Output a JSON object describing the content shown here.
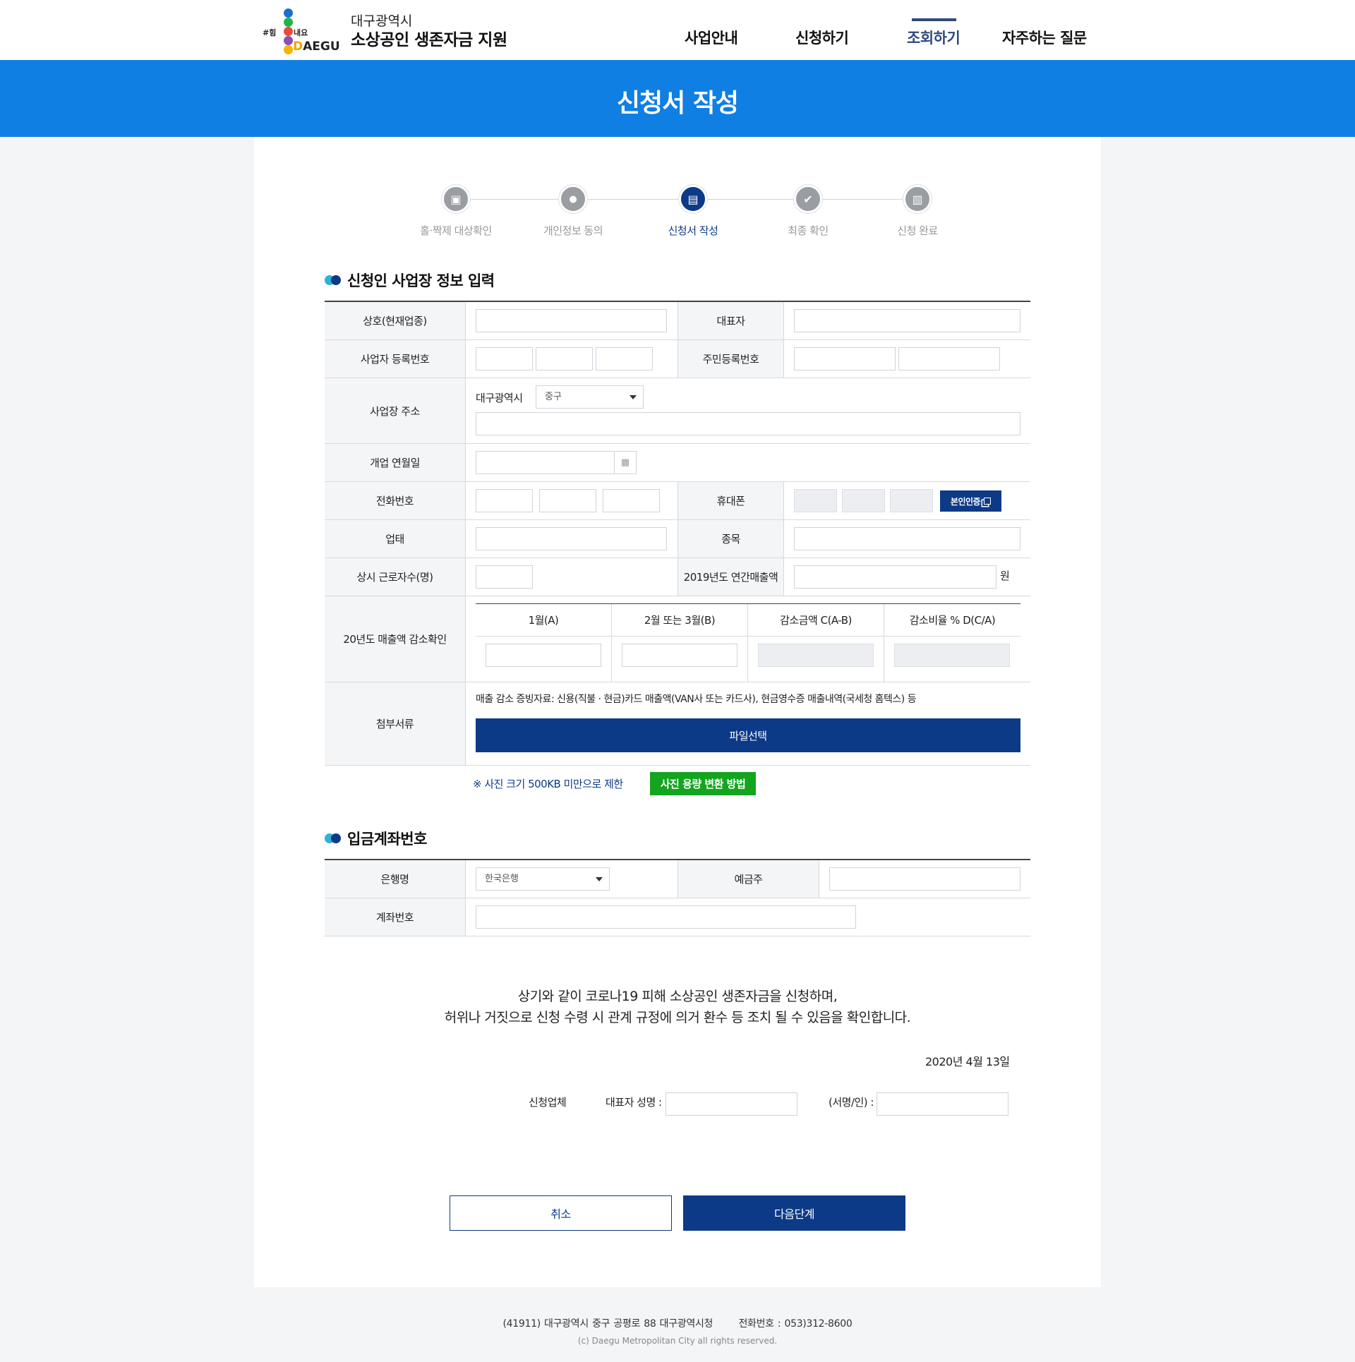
{
  "header": {
    "logo": {
      "hash": "#힘",
      "nae": "내요",
      "daegu_prefix": "D",
      "daegu_rest": "AEGU"
    },
    "subtitle": "대구광역시",
    "title": "소상공인 생존자금 지원",
    "nav": [
      {
        "label": "사업안내"
      },
      {
        "label": "신청하기"
      },
      {
        "label": "조회하기"
      },
      {
        "label": "자주하는 질문"
      }
    ]
  },
  "banner": {
    "title": "신청서 작성"
  },
  "steps": [
    {
      "label": "홀·짝제 대상확인",
      "icon": "calendar-check-icon",
      "glyph": "▣"
    },
    {
      "label": "개인정보 동의",
      "icon": "lock-icon",
      "glyph": "🔒"
    },
    {
      "label": "신청서 작성",
      "icon": "document-icon",
      "glyph": "▤"
    },
    {
      "label": "최종 확인",
      "icon": "check-icon",
      "glyph": "✔"
    },
    {
      "label": "신청 완료",
      "icon": "briefcase-icon",
      "glyph": "▥"
    }
  ],
  "section_business": {
    "heading": "신청인 사업장 정보 입력",
    "rows": {
      "trade_name": "상호(현재업종)",
      "representative": "대표자",
      "biz_reg_no": "사업자 등록번호",
      "resident_no": "주민등록번호",
      "address": "사업장 주소",
      "address_city": "대구광역시",
      "address_district": "중구",
      "open_date": "개업 연월일",
      "phone": "전화번호",
      "mobile": "휴대폰",
      "verify_button": "본인인증",
      "biz_type": "업태",
      "biz_item": "종목",
      "employees": "상시 근로자수(명)",
      "annual_sales": "2019년도 연간매출액",
      "won": "원",
      "sales_decrease": "20년도 매출액 감소확인",
      "sales_cols": [
        "1월(A)",
        "2월 또는 3월(B)",
        "감소금액 C(A-B)",
        "감소비율 % D(C/A)"
      ],
      "attachments": "첨부서류",
      "attachments_note": "매출 감소 증빙자료: 신용(직불 · 현금)카드 매출액(VAN사 또는 카드사), 현금영수증 매출내역(국세청 홈텍스) 등",
      "file_button": "파일선택"
    },
    "photo_note": "※ 사진 크기 500KB 미만으로 제한",
    "photo_button": "사진 용량 변환 방법"
  },
  "section_account": {
    "heading": "입금계좌번호",
    "bank_label": "은행명",
    "bank_value": "한국은행",
    "holder_label": "예금주",
    "account_label": "계좌번호"
  },
  "statement": {
    "line1": "상기와 같이 코로나19 피해 소상공인 생존자금을 신청하며,",
    "line2": "허위나 거짓으로 신청 수령 시 관계 규정에 의거 환수 등 조치 될 수 있음을 확인합니다.",
    "date": "2020년 4월 13일",
    "applicant": "신청업체",
    "rep_name": "대표자 성명 :",
    "signature": "(서명/인) :"
  },
  "buttons": {
    "cancel": "취소",
    "next": "다음단계"
  },
  "footer": {
    "address": "(41911) 대구광역시 중구 공평로 88 대구광역시청",
    "phone": "전화번호 : 053)312-8600",
    "copyright": "(c) Daegu Metropolitan City all rights reserved."
  },
  "colors": {
    "primary": "#0d3a87",
    "banner": "#0f7fe3",
    "green": "#13a51f"
  }
}
